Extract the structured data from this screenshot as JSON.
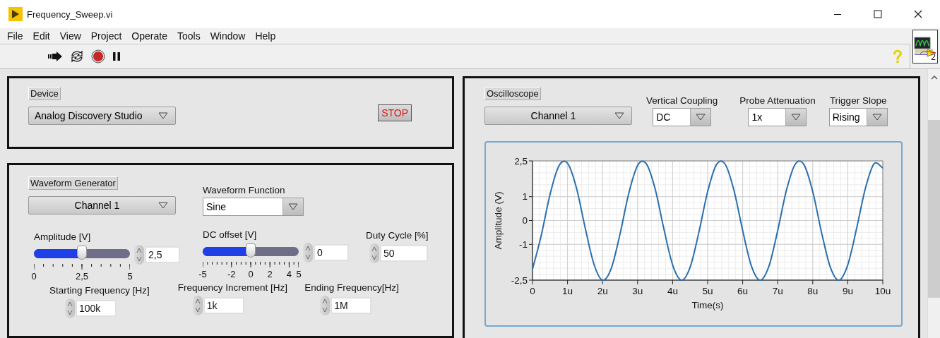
{
  "window": {
    "title": "Frequency_Sweep.vi"
  },
  "menu": [
    "File",
    "Edit",
    "View",
    "Project",
    "Operate",
    "Tools",
    "Window",
    "Help"
  ],
  "vi_icon": {
    "label": "2"
  },
  "device_panel": {
    "label": "Device",
    "device": "Analog Discovery Studio",
    "stop_button": "STOP"
  },
  "waveform_generator": {
    "label": "Waveform Generator",
    "channel": "Channel 1",
    "function": {
      "label": "Waveform Function",
      "value": "Sine"
    },
    "amplitude": {
      "label": "Amplitude [V]",
      "level": 0.5,
      "scale": [
        "0",
        "2,5",
        "5"
      ],
      "value": "2,5"
    },
    "dc_offset": {
      "label": "DC offset [V]",
      "level": 0.5,
      "scale": [
        "-5",
        "-2",
        "0",
        "2",
        "4",
        "5"
      ],
      "value": "0"
    },
    "duty_cycle": {
      "label": "Duty Cycle [%]",
      "value": "50"
    },
    "starting_frequency": {
      "label": "Starting Frequency [Hz]",
      "value": "100k"
    },
    "frequency_increment": {
      "label": "Frequency Increment [Hz]",
      "value": "1k"
    },
    "ending_frequency": {
      "label": "Ending Frequency[Hz]",
      "value": "1M"
    }
  },
  "oscilloscope": {
    "label": "Oscilloscope",
    "channel": "Channel 1",
    "vertical_coupling": {
      "label": "Vertical Coupling",
      "value": "DC"
    },
    "probe_attenuation": {
      "label": "Probe Attenuation",
      "value": "1x"
    },
    "trigger_slope": {
      "label": "Trigger Slope",
      "value": "Rising"
    },
    "chart_data": {
      "type": "line",
      "grid": true,
      "xlabel": "Time(s)",
      "ylabel": "Amplitude (V)",
      "x": [
        0,
        0.25,
        0.5,
        0.75,
        1,
        1.25,
        1.5,
        1.75,
        2,
        2.25,
        2.5,
        2.75,
        3,
        3.25,
        3.5,
        3.75,
        4,
        4.25,
        4.5,
        4.75,
        5,
        5.25,
        5.5,
        5.75,
        6,
        6.25,
        6.5,
        6.75,
        7,
        7.25,
        7.5,
        7.75,
        8,
        8.25,
        8.5,
        8.75,
        9,
        9.25,
        9.5,
        9.75,
        10
      ],
      "series": [
        {
          "color": "#2a6fae",
          "values": [
            -2.04,
            -0.62,
            1.09,
            2.28,
            2.4,
            1.39,
            -0.28,
            -1.81,
            -2.5,
            -2.0,
            -0.56,
            1.15,
            2.31,
            2.38,
            1.33,
            -0.35,
            -1.86,
            -2.5,
            -1.96,
            -0.49,
            1.21,
            2.34,
            2.36,
            1.27,
            -0.42,
            -1.91,
            -2.5,
            -1.91,
            -0.42,
            1.27,
            2.36,
            2.34,
            1.21,
            -0.49,
            -1.95,
            -2.5,
            -1.86,
            -0.35,
            1.33,
            2.38,
            2.2
          ]
        }
      ],
      "xlim": [
        0,
        10
      ],
      "ylim": [
        -2.5,
        2.5
      ],
      "xticks": [
        {
          "value": 0,
          "label": "0"
        },
        {
          "value": 1,
          "label": "1u"
        },
        {
          "value": 2,
          "label": "2u"
        },
        {
          "value": 3,
          "label": "3u"
        },
        {
          "value": 4,
          "label": "4u"
        },
        {
          "value": 5,
          "label": "5u"
        },
        {
          "value": 6,
          "label": "6u"
        },
        {
          "value": 7,
          "label": "7u"
        },
        {
          "value": 8,
          "label": "8u"
        },
        {
          "value": 9,
          "label": "9u"
        },
        {
          "value": 10,
          "label": "10u"
        }
      ],
      "yticks": [
        {
          "value": 2.5,
          "label": "2,5"
        },
        {
          "value": 1,
          "label": "1"
        },
        {
          "value": 0,
          "label": "0"
        },
        {
          "value": -1,
          "label": "-1"
        },
        {
          "value": -2.5,
          "label": "-2,5"
        }
      ]
    }
  }
}
